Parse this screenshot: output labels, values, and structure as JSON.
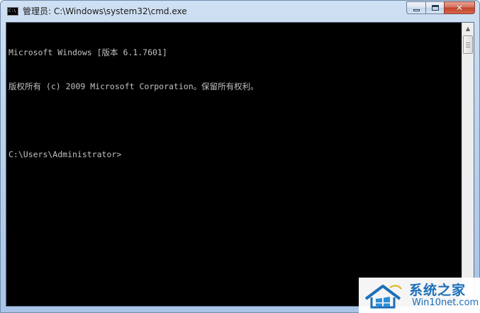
{
  "window": {
    "title": "管理员: C:\\Windows\\system32\\cmd.exe",
    "app_icon": "cmd-icon",
    "app_icon_text": "C:\\",
    "controls": {
      "minimize": "minimize-icon",
      "maximize": "maximize-icon",
      "close_glyph": "✕"
    }
  },
  "console": {
    "lines": [
      "Microsoft Windows [版本 6.1.7601]",
      "版权所有 (c) 2009 Microsoft Corporation。保留所有权利。",
      "",
      "C:\\Users\\Administrator>"
    ],
    "colors": {
      "background": "#000000",
      "text": "#c0c0c0"
    }
  },
  "scrollbar": {
    "up_glyph": "▲",
    "down_glyph": "▼"
  },
  "watermark": {
    "name": "系统之家",
    "site": "Win10net.com"
  },
  "colors": {
    "frame": "#bcd3ee",
    "close_button": "#c0412a",
    "watermark": "#1b6fb8"
  }
}
